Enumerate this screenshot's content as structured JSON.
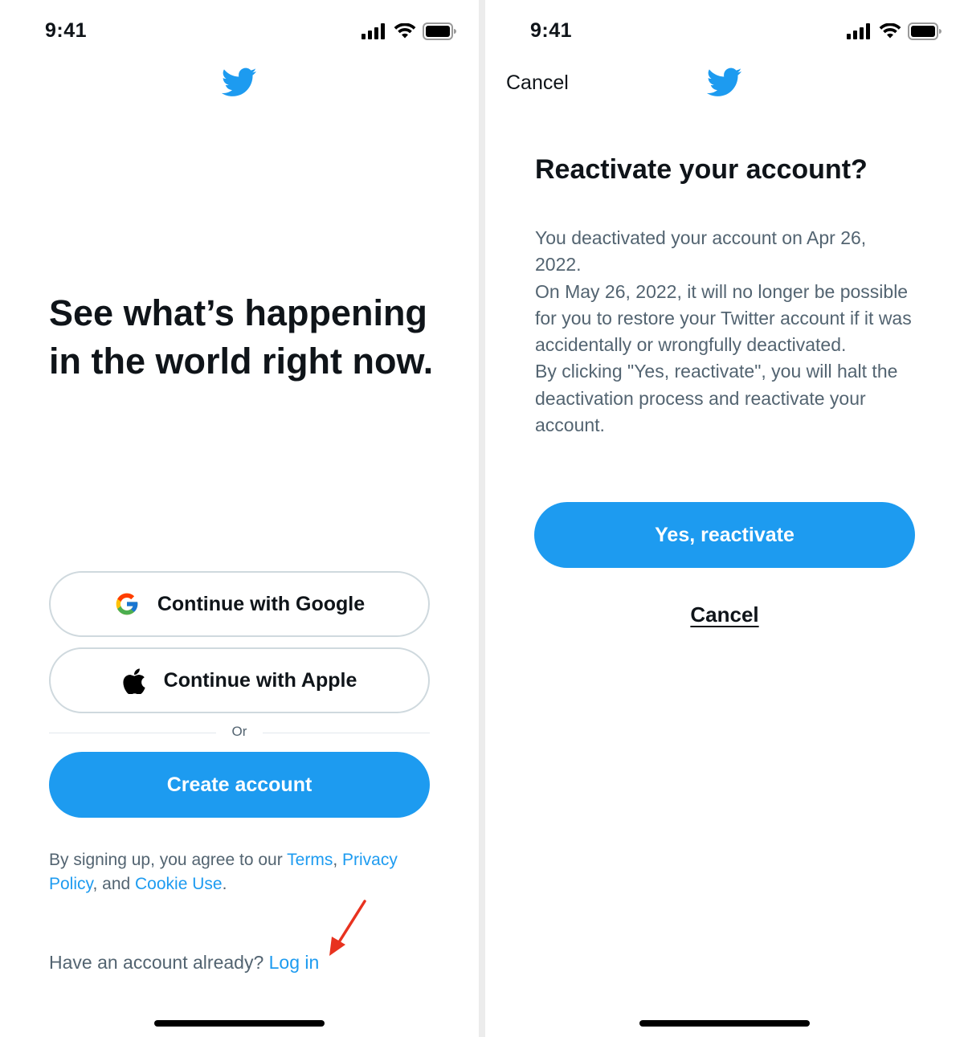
{
  "colors": {
    "accent": "#1d9bf0",
    "text_primary": "#0f1419",
    "text_secondary": "#536471",
    "border": "#cfd9de",
    "annotation_arrow": "#e8321f"
  },
  "left_screen": {
    "status_bar": {
      "time": "9:41",
      "icons": [
        "cellular-signal-icon",
        "wifi-icon",
        "battery-icon"
      ]
    },
    "logo_icon": "twitter-bird-icon",
    "headline": "See what’s happening in the world right now.",
    "google_button": {
      "label": "Continue with Google",
      "icon": "google-g-icon"
    },
    "apple_button": {
      "label": "Continue with Apple",
      "icon": "apple-logo-icon"
    },
    "divider_text": "Or",
    "create_account_button": {
      "label": "Create account"
    },
    "legal": {
      "prefix": "By signing up, you agree to our ",
      "terms": "Terms",
      "comma": ", ",
      "privacy": "Privacy Policy",
      "and": ", and ",
      "cookie": "Cookie Use",
      "period": "."
    },
    "login": {
      "prompt": "Have an account already? ",
      "link": "Log in"
    },
    "annotation_icon": "red-arrow-icon"
  },
  "right_screen": {
    "status_bar": {
      "time": "9:41",
      "icons": [
        "cellular-signal-icon",
        "wifi-icon",
        "battery-icon"
      ]
    },
    "top_cancel": "Cancel",
    "logo_icon": "twitter-bird-icon",
    "title": "Reactivate your account?",
    "body": [
      "You deactivated your account on Apr 26, 2022.",
      "On May 26, 2022, it will no longer be possible for you to restore your Twitter account if it was accidentally or wrongfully deactivated.",
      "By clicking \"Yes, reactivate\", you will halt the deactivation process and reactivate your account."
    ],
    "reactivate_button": "Yes, reactivate",
    "bottom_cancel": "Cancel"
  }
}
